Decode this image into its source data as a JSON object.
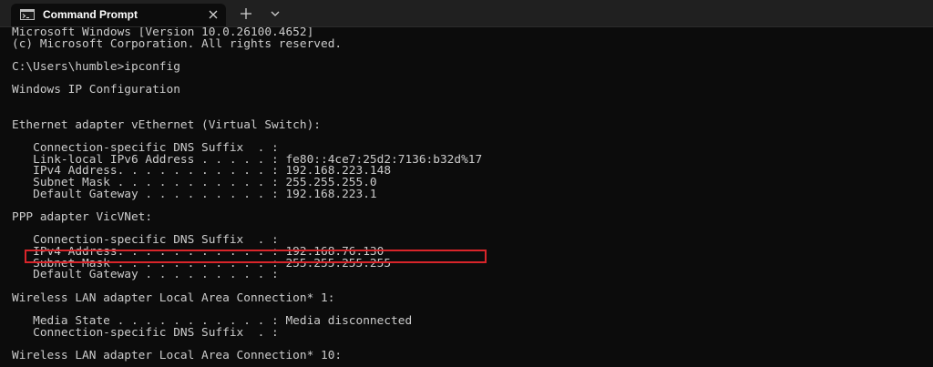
{
  "window": {
    "tab_title": "Command Prompt",
    "icons": {
      "tab_icon": "terminal-icon",
      "close": "close-icon",
      "new_tab": "plus-icon",
      "dropdown": "chevron-down-icon"
    },
    "colors": {
      "titlebar": "#202020",
      "console_bg": "#0c0c0c",
      "console_text": "#cccccc",
      "highlight": "#d9252a"
    }
  },
  "console": {
    "lines": [
      "Microsoft Windows [Version 10.0.26100.4652]",
      "(c) Microsoft Corporation. All rights reserved.",
      "",
      "C:\\Users\\humble>ipconfig",
      "",
      "Windows IP Configuration",
      "",
      "",
      "Ethernet adapter vEthernet (Virtual Switch):",
      "",
      "   Connection-specific DNS Suffix  . :",
      "   Link-local IPv6 Address . . . . . : fe80::4ce7:25d2:7136:b32d%17",
      "   IPv4 Address. . . . . . . . . . . : 192.168.223.148",
      "   Subnet Mask . . . . . . . . . . . : 255.255.255.0",
      "   Default Gateway . . . . . . . . . : 192.168.223.1",
      "",
      "PPP adapter VicVNet:",
      "",
      "   Connection-specific DNS Suffix  . :",
      "   IPv4 Address. . . . . . . . . . . : 192.168.76.130",
      "   Subnet Mask . . . . . . . . . . . : 255.255.255.255",
      "   Default Gateway . . . . . . . . . :",
      "",
      "Wireless LAN adapter Local Area Connection* 1:",
      "",
      "   Media State . . . . . . . . . . . : Media disconnected",
      "   Connection-specific DNS Suffix  . :",
      "",
      "Wireless LAN adapter Local Area Connection* 10:"
    ]
  }
}
